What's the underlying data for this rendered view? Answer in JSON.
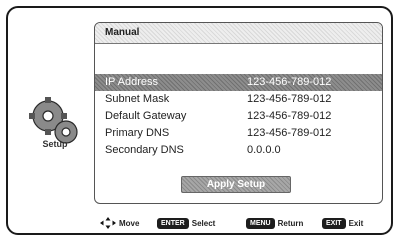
{
  "sidebar": {
    "label": "Setup",
    "icon": "gears-icon"
  },
  "panel": {
    "title": "Manual",
    "rows": [
      {
        "label": "IP Address",
        "value": "123-456-789-012",
        "selected": true
      },
      {
        "label": "Subnet Mask",
        "value": "123-456-789-012"
      },
      {
        "label": "Default Gateway",
        "value": "123-456-789-012"
      },
      {
        "label": "Primary DNS",
        "value": "123-456-789-012"
      },
      {
        "label": "Secondary DNS",
        "value": "0.0.0.0"
      }
    ],
    "apply_label": "Apply Setup"
  },
  "footer": {
    "move_label": "Move",
    "enter_key": "ENTER",
    "select_label": "Select",
    "menu_key": "MENU",
    "return_label": "Return",
    "exit_key": "EXIT",
    "exit_label": "Exit"
  }
}
